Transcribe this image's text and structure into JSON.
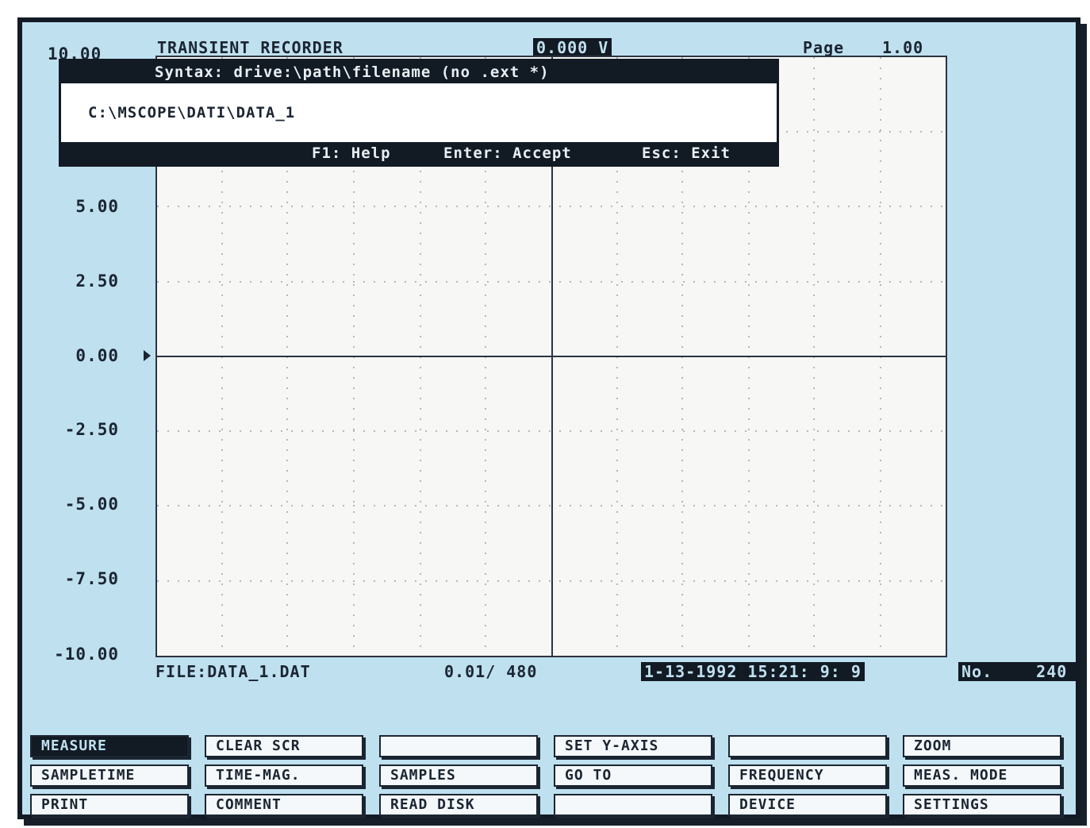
{
  "header": {
    "title": "TRANSIENT RECORDER",
    "top_readout": "0.000 V",
    "page_label": "Page",
    "page_value": "1.00",
    "y_top_partial": "10.00"
  },
  "y_axis": {
    "labels": [
      "5.00",
      "2.50",
      "0.00",
      "-2.50",
      "-5.00",
      "-7.50",
      "-10.00"
    ]
  },
  "dialog": {
    "syntax": "Syntax: drive:\\path\\filename (no .ext *)",
    "path_value": "C:\\MSCOPE\\DATI\\DATA_1",
    "help": "F1: Help",
    "accept": "Enter: Accept",
    "exit": "Esc: Exit"
  },
  "status": {
    "file": "FILE:DATA_1.DAT",
    "timebase": "0.01/  480",
    "datetime": "1-13-1992  15:21: 9: 9",
    "no_label": "No.",
    "no_value": "240"
  },
  "buttons": [
    [
      "MEASURE",
      "CLEAR SCR",
      "",
      "SET Y-AXIS",
      "",
      "ZOOM"
    ],
    [
      "SAMPLETIME",
      "TIME-MAG.",
      "SAMPLES",
      "GO TO",
      "FREQUENCY",
      "MEAS. MODE"
    ],
    [
      "PRINT",
      "COMMENT",
      "READ DISK",
      "",
      "DEVICE",
      "SETTINGS"
    ]
  ],
  "colors": {
    "background": "#bfe0ef",
    "plot_area": "#f7f7f5",
    "frame": "#121a24"
  }
}
